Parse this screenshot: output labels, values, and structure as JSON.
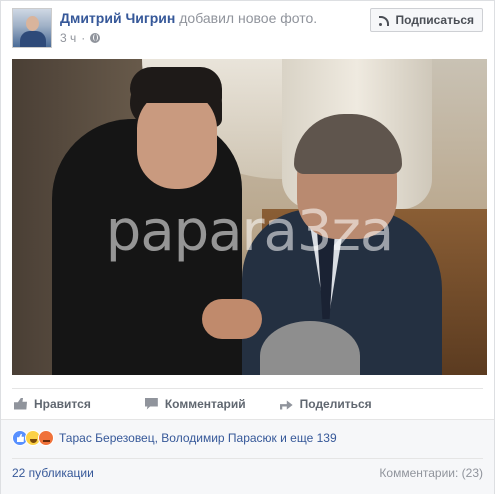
{
  "post": {
    "author": "Дмитрий Чигрин",
    "action": "добавил новое фото.",
    "time": "3 ч",
    "privacy_icon": "globe-icon",
    "subscribe_label": "Подписаться",
    "subscribe_icon": "rss-icon"
  },
  "photo": {
    "watermark": "papara3za"
  },
  "actions": {
    "like_label": "Нравится",
    "comment_label": "Комментарий",
    "share_label": "Поделиться"
  },
  "reactions": {
    "icons": [
      "like-icon",
      "haha-icon",
      "angry-icon"
    ],
    "summary": "Тарас Березовец, Володимир Парасюк и еще 139"
  },
  "footer": {
    "shares": "22 публикации",
    "comments": "Комментарии: (23)"
  },
  "colors": {
    "link": "#365899",
    "muted": "#90949c",
    "background": "#f6f7f9"
  }
}
